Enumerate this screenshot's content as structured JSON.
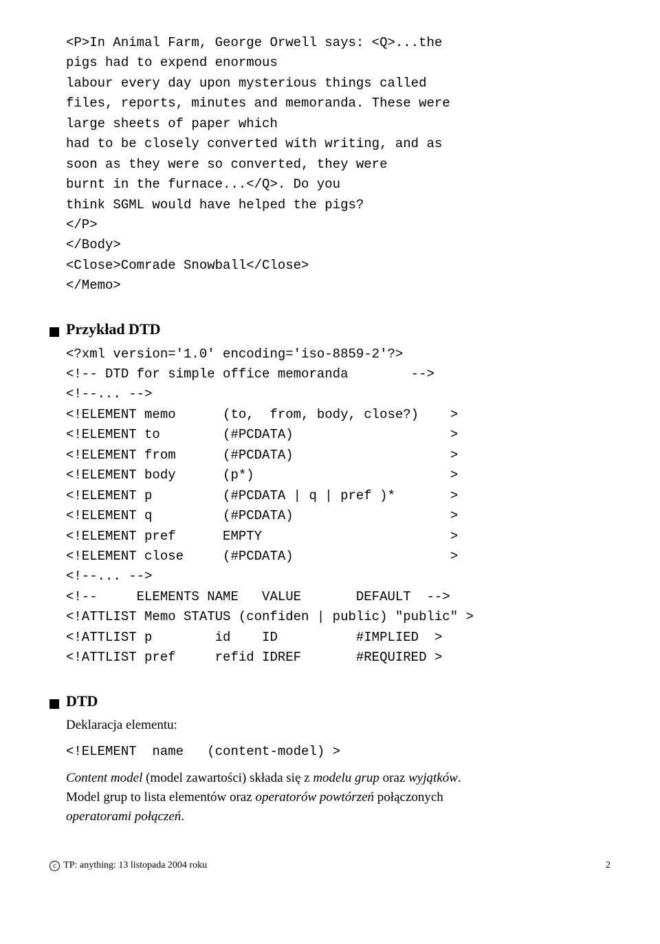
{
  "memo_code": "<P>In Animal Farm, George Orwell says: <Q>...the\npigs had to expend enormous\nlabour every day upon mysterious things called\nfiles, reports, minutes and memoranda. These were\nlarge sheets of paper which\nhad to be closely converted with writing, and as\nsoon as they were so converted, they were\nburnt in the furnace...</Q>. Do you\nthink SGML would have helped the pigs?\n</P>\n</Body>\n<Close>Comrade Snowball</Close>\n</Memo>",
  "sect1_title": "Przykład DTD",
  "dtd_code": "<?xml version='1.0' encoding='iso-8859-2'?>\n<!-- DTD for simple office memoranda        -->\n<!--... -->\n<!ELEMENT memo      (to,  from, body, close?)    >\n<!ELEMENT to        (#PCDATA)                    >\n<!ELEMENT from      (#PCDATA)                    >\n<!ELEMENT body      (p*)                         >\n<!ELEMENT p         (#PCDATA | q | pref )*       >\n<!ELEMENT q         (#PCDATA)                    >\n<!ELEMENT pref      EMPTY                        >\n<!ELEMENT close     (#PCDATA)                    >\n<!--... -->\n<!--     ELEMENTS NAME   VALUE       DEFAULT  -->\n<!ATTLIST Memo STATUS (confiden | public) \"public\" >\n<!ATTLIST p        id    ID          #IMPLIED  >\n<!ATTLIST pref     refid IDREF       #REQUIRED >",
  "sect2_title": "DTD",
  "declaration_label": "Deklaracja elementu:",
  "element_syntax": "<!ELEMENT  name   (content-model) >",
  "content_model_em": "Content model",
  "body_frag1": " (model zawartości) składa się z ",
  "model_grup_em": "modelu grup",
  "body_frag2": " oraz ",
  "wyjatkow_em": "wyjątków",
  "body_frag3": ".",
  "body_line2a": "Model grup to lista elementów oraz ",
  "op_powt_em": "operatorów powtórzeń",
  "body_line2b": " połączonych",
  "op_pol_em": "operatorami połączeń",
  "body_frag_end": ".",
  "footer_left": " TP: anything: 13 listopada 2004 roku",
  "footer_right": "2",
  "copyright": "c"
}
